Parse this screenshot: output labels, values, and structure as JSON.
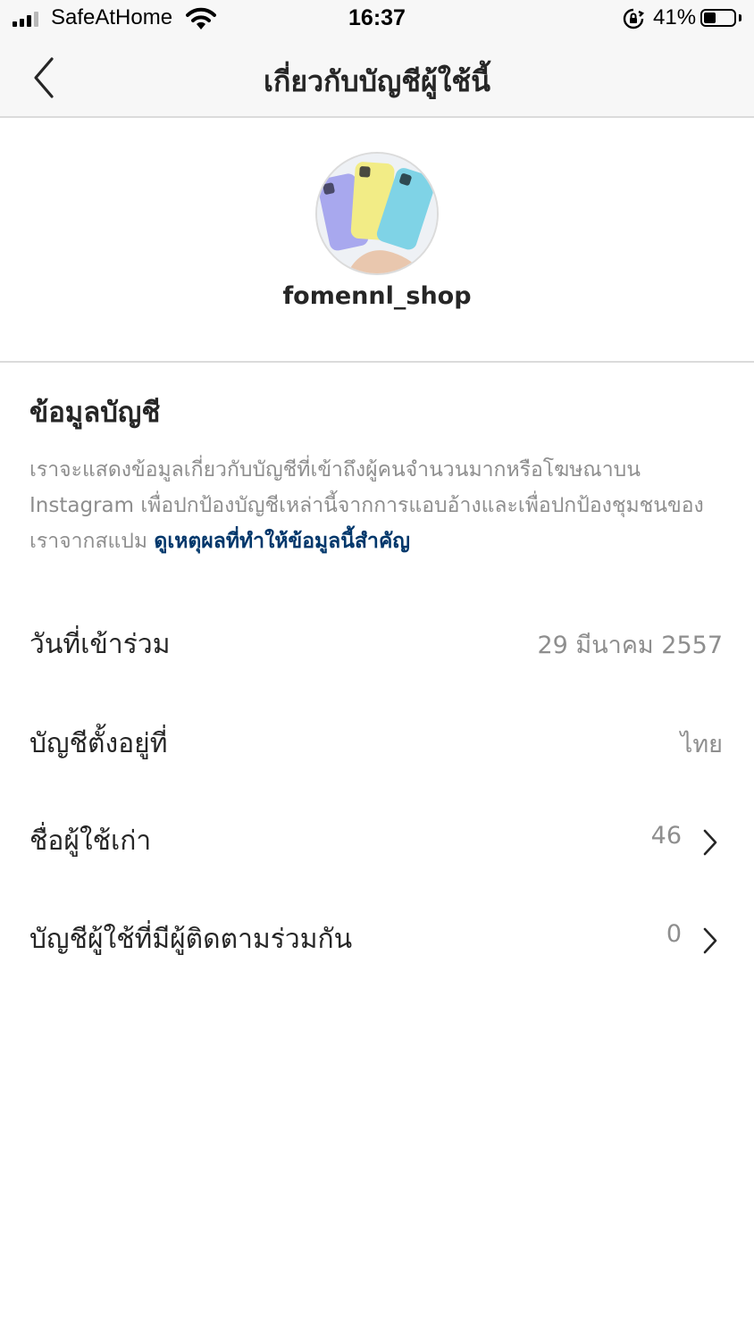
{
  "status_bar": {
    "carrier": "SafeAtHome",
    "time": "16:37",
    "battery_percent_label": "41%",
    "battery_level": 0.41,
    "signal_bars": 3,
    "icons": [
      "signal-icon",
      "wifi-icon",
      "rotation-lock-icon",
      "battery-icon"
    ]
  },
  "nav": {
    "title": "เกี่ยวกับบัญชีผู้ใช้นี้",
    "back_icon": "chevron-left-icon"
  },
  "profile": {
    "username": "fomennl_shop",
    "avatar_icon": "profile-avatar-phones"
  },
  "account_info": {
    "heading": "ข้อมูลบัญชี",
    "description_line1": "เราจะแสดงข้อมูลเกี่ยวกับบัญชีที่เข้าถึงผู้คนจำนวนมากหรือโฆษณาบน",
    "description_line2": "Instagram เพื่อปกป้องบัญชีเหล่านี้จากการแอบอ้างและเพื่อปกป้องชุมชนของ",
    "description_line3": "เราจากสแปม",
    "link_text": "ดูเหตุผลที่ทำให้ข้อมูลนี้สำคัญ"
  },
  "rows": [
    {
      "label": "วันที่เข้าร่วม",
      "value": "29 มีนาคม 2557",
      "has_chevron": false
    },
    {
      "label": "บัญชีตั้งอยู่ที่",
      "value": "ไทย",
      "has_chevron": false
    },
    {
      "label": "ชื่อผู้ใช้เก่า",
      "value": "46",
      "has_chevron": true
    },
    {
      "label": "บัญชีผู้ใช้ที่มีผู้ติดตามร่วมกัน",
      "value": "0",
      "has_chevron": true
    }
  ],
  "colors": {
    "text_primary": "#262626",
    "text_secondary": "#8e8e8e",
    "link": "#00376b",
    "bar_background": "#f7f7f7",
    "divider": "#dbdbdb"
  }
}
